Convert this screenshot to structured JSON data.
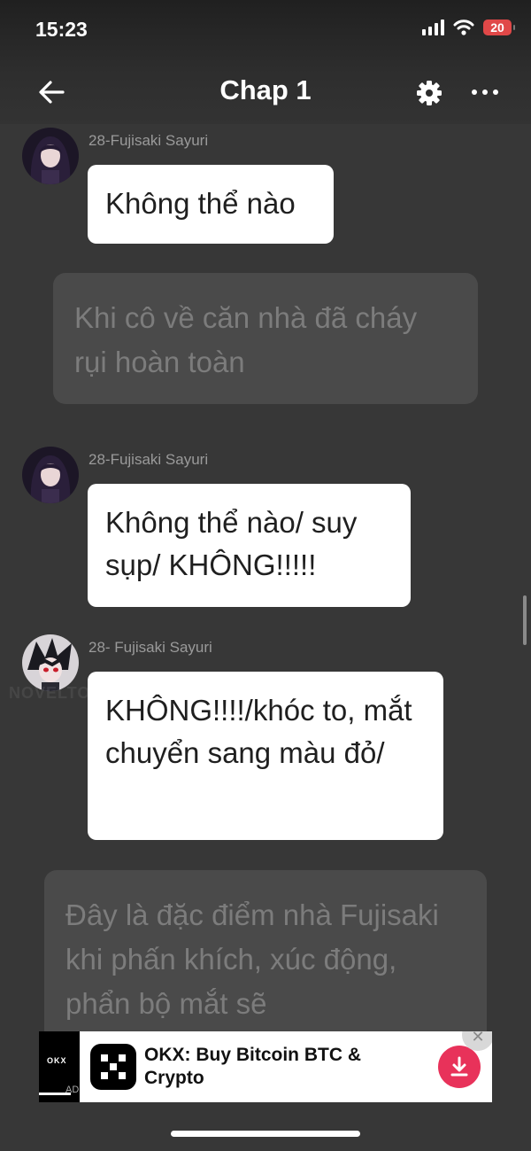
{
  "status_bar": {
    "time": "15:23",
    "battery": "20"
  },
  "header": {
    "title": "Chap 1"
  },
  "messages": [
    {
      "type": "chat",
      "name": "28-Fujisaki Sayuri",
      "text": "Không thể nào"
    },
    {
      "type": "narration",
      "text": "Khi cô về căn nhà đã cháy rụi hoàn toàn"
    },
    {
      "type": "chat",
      "name": "28-Fujisaki Sayuri",
      "text": "Không thể nào/ suy sụp/ KHÔNG!!!!!"
    },
    {
      "type": "chat",
      "name": "28- Fujisaki Sayuri",
      "text": "KHÔNG!!!!/khóc to, mắt chuyển sang màu đỏ/"
    },
    {
      "type": "narration",
      "text": "Đây là đặc điểm nhà Fujisaki khi phấn khích, xúc động, phẩn bộ mắt sẽ"
    }
  ],
  "watermark": "NOVELTOON",
  "ad": {
    "title": "OKX: Buy Bitcoin BTC & Crypto",
    "brand": "OKX",
    "badge": "AD"
  },
  "icons": {
    "back": "arrow-left-icon",
    "settings": "gear-icon",
    "more": "more-dots-icon",
    "download": "download-icon",
    "close": "close-icon"
  },
  "colors": {
    "background": "#373737",
    "bubble": "#ffffff",
    "narration_bg": "#4a4a4a",
    "ad_download": "#e8325a",
    "battery": "#e04848"
  }
}
